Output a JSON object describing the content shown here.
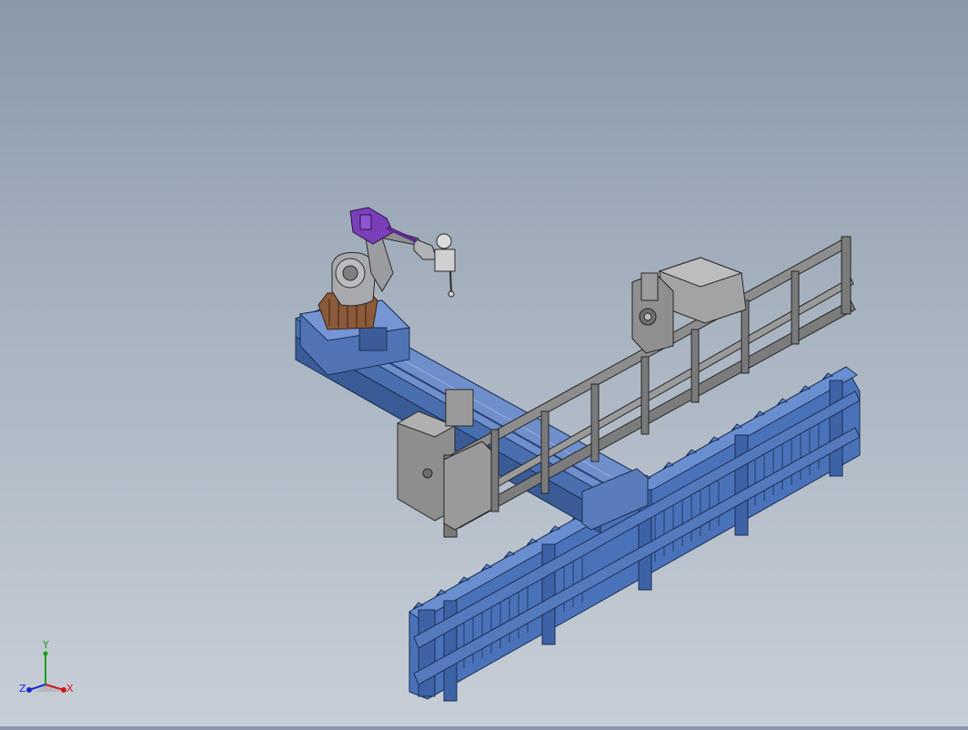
{
  "scene": {
    "background_top": "#8a98aa",
    "background_bottom": "#c7ced6",
    "objects": [
      {
        "name": "welding-robot-arm",
        "color": "#8b8b8b"
      },
      {
        "name": "welding-torch-purple-end",
        "color": "#7a3fb8"
      },
      {
        "name": "robot-base-brown",
        "color": "#8a5a3a"
      },
      {
        "name": "linear-rail-track-blue",
        "color": "#4a6fae"
      },
      {
        "name": "gray-steel-frame",
        "color": "#7c7c7c"
      },
      {
        "name": "blue-workpiece-rack",
        "color": "#4a72b8"
      }
    ]
  },
  "triad": {
    "x_label": "X",
    "y_label": "Y",
    "z_label": "Z",
    "x_color": "#d01818",
    "y_color": "#1aa01a",
    "z_color": "#1a2ad0"
  }
}
